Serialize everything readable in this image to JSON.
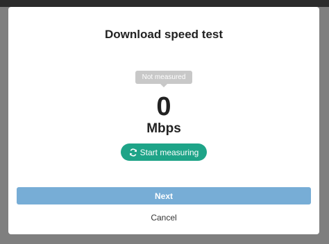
{
  "dialog": {
    "title": "Download speed test",
    "status": "Not measured",
    "speed_value": "0",
    "speed_unit": "Mbps",
    "start_button": {
      "label": "Start measuring",
      "icon": "refresh-icon"
    },
    "next_label": "Next",
    "cancel_label": "Cancel"
  },
  "colors": {
    "start_button": "#1ea488",
    "next_button": "#77add6",
    "status_badge": "#c8c8c8"
  }
}
